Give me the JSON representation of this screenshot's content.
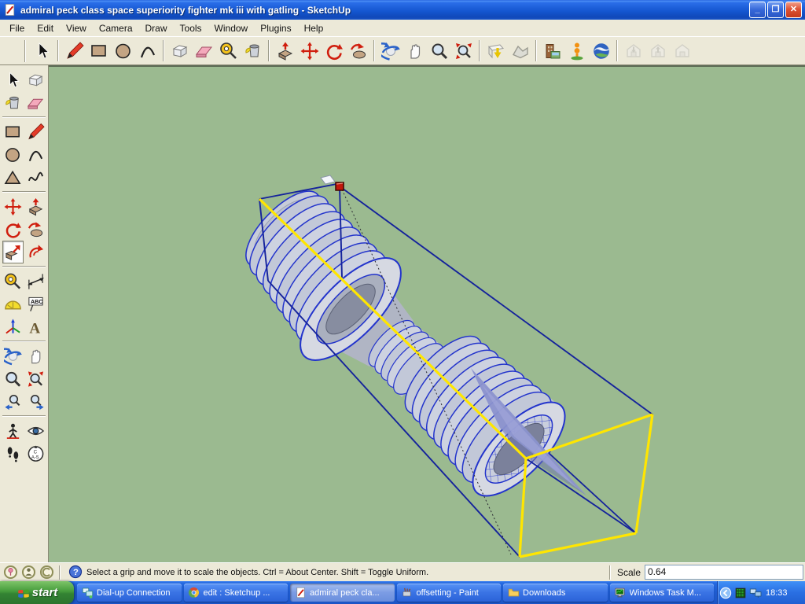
{
  "window": {
    "title": "admiral peck class space superiority fighter mk iii with gatling - SketchUp",
    "app_icon": "sketchup-pencil-icon",
    "controls": [
      {
        "name": "minimize",
        "glyph": "_"
      },
      {
        "name": "restore",
        "glyph": "❐"
      },
      {
        "name": "close",
        "glyph": "✕"
      }
    ]
  },
  "menu_bar": {
    "items": [
      "File",
      "Edit",
      "View",
      "Camera",
      "Draw",
      "Tools",
      "Window",
      "Plugins",
      "Help"
    ]
  },
  "top_toolbar": {
    "groups": [
      {
        "items": [
          {
            "icon": "select"
          }
        ]
      },
      {
        "items": [
          {
            "icon": "line"
          },
          {
            "icon": "rectangle"
          },
          {
            "icon": "circle"
          },
          {
            "icon": "arc"
          }
        ]
      },
      {
        "items": [
          {
            "icon": "make-component"
          },
          {
            "icon": "eraser"
          },
          {
            "icon": "tape-measure"
          },
          {
            "icon": "paint-bucket"
          }
        ]
      },
      {
        "items": [
          {
            "icon": "push-pull"
          },
          {
            "icon": "move"
          },
          {
            "icon": "rotate"
          },
          {
            "icon": "follow-me"
          }
        ]
      },
      {
        "items": [
          {
            "icon": "orbit"
          },
          {
            "icon": "pan"
          },
          {
            "icon": "zoom"
          },
          {
            "icon": "zoom-extents"
          }
        ]
      },
      {
        "items": [
          {
            "icon": "add-location"
          },
          {
            "icon": "toggle-terrain"
          }
        ]
      },
      {
        "items": [
          {
            "icon": "photo-textures"
          },
          {
            "icon": "add-building"
          },
          {
            "icon": "google-earth"
          }
        ]
      },
      {
        "items": [
          {
            "icon": "get-models",
            "disabled": true
          },
          {
            "icon": "share-model",
            "disabled": true
          },
          {
            "icon": "share-component",
            "disabled": true
          }
        ]
      }
    ]
  },
  "left_toolbar": {
    "active_tool": "scale",
    "groups": [
      {
        "rows": [
          [
            "select",
            "make-component"
          ],
          [
            "paint-bucket",
            "eraser"
          ]
        ]
      },
      {
        "rows": [
          [
            "rectangle",
            "line"
          ],
          [
            "circle",
            "arc"
          ],
          [
            "polygon",
            "freehand"
          ]
        ]
      },
      {
        "rows": [
          [
            "move",
            "push-pull"
          ],
          [
            "rotate",
            "follow-me"
          ],
          [
            "scale",
            "offset"
          ]
        ]
      },
      {
        "rows": [
          [
            "tape-measure",
            "dimension"
          ],
          [
            "protractor",
            "text"
          ],
          [
            "axes",
            "3d-text"
          ]
        ]
      },
      {
        "rows": [
          [
            "orbit",
            "pan"
          ],
          [
            "zoom",
            "zoom-extents"
          ],
          [
            "previous-view",
            "next-view"
          ]
        ]
      },
      {
        "rows": [
          [
            "position-camera",
            "look-around"
          ],
          [
            "walk",
            "section-plane"
          ]
        ]
      }
    ]
  },
  "viewport": {
    "description": "3d model of twin ribbed engine nacelles with exhaust cone, selected, being scaled inside bounding box",
    "colors": {
      "background": "#9bba90",
      "selection_blue": "#2334cc",
      "box_blue": "#15239b",
      "highlight_yellow": "#ffe600",
      "grip_red": "#c2170b",
      "model_gray": "#c2c8d8",
      "model_gray_light": "#d6d9e2",
      "model_gray_dark": "#878da0",
      "cone_purple": "#8b92cd"
    }
  },
  "status_bar": {
    "model_icons": [
      "geolocation",
      "credits",
      "claim"
    ],
    "help_icon": "question-mark",
    "message": "Select a grip and move it to scale the objects. Ctrl = About Center. Shift = Toggle Uniform.",
    "measurement": {
      "label": "Scale",
      "value": "0.64"
    }
  },
  "taskbar": {
    "start": {
      "label": "start",
      "icon": "windows-logo"
    },
    "buttons": [
      {
        "label": "Dial-up Connection",
        "icon": "dialup",
        "active": false
      },
      {
        "label": "edit : Sketchup ...",
        "icon": "chrome",
        "active": false
      },
      {
        "label": "admiral peck cla...",
        "icon": "sketchup",
        "active": true
      },
      {
        "label": "offsetting - Paint",
        "icon": "paint",
        "active": false
      },
      {
        "label": "Downloads",
        "icon": "folder",
        "active": false
      },
      {
        "label": "Windows Task M...",
        "icon": "taskman",
        "active": false
      }
    ],
    "tray": {
      "icons": [
        "chevron",
        "meter",
        "network"
      ],
      "clock": "18:33"
    }
  }
}
